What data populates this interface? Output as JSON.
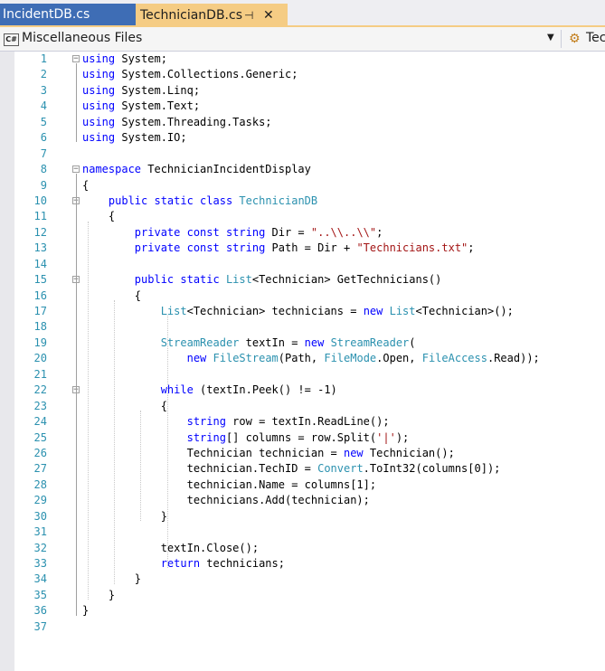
{
  "tabs": [
    {
      "label": "IncidentDB.cs",
      "active": false
    },
    {
      "label": "TechnicianDB.cs",
      "active": true,
      "pin_icon": "pin-icon",
      "close_icon": "close-icon"
    }
  ],
  "navbar": {
    "project_icon_text": "C#",
    "project_label": "Miscellaneous Files",
    "class_label": "Tec"
  },
  "code": [
    {
      "n": "1",
      "fold": "-",
      "parts": [
        [
          "kw",
          "using"
        ],
        [
          "",
          "System;"
        ]
      ]
    },
    {
      "n": "2",
      "parts": [
        [
          "kw",
          "using"
        ],
        [
          "",
          "System.Collections.Generic;"
        ]
      ]
    },
    {
      "n": "3",
      "parts": [
        [
          "kw",
          "using"
        ],
        [
          "",
          "System.Linq;"
        ]
      ]
    },
    {
      "n": "4",
      "parts": [
        [
          "kw",
          "using"
        ],
        [
          "",
          "System.Text;"
        ]
      ]
    },
    {
      "n": "5",
      "parts": [
        [
          "kw",
          "using"
        ],
        [
          "",
          "System.Threading.Tasks;"
        ]
      ]
    },
    {
      "n": "6",
      "parts": [
        [
          "kw",
          "using"
        ],
        [
          "",
          "System.IO;"
        ]
      ]
    },
    {
      "n": "7",
      "parts": []
    },
    {
      "n": "8",
      "fold": "-",
      "parts": [
        [
          "kw",
          "namespace"
        ],
        [
          "",
          " TechnicianIncidentDisplay"
        ]
      ]
    },
    {
      "n": "9",
      "parts": [
        [
          "",
          "{"
        ]
      ]
    },
    {
      "n": "10",
      "fold": "-",
      "parts": [
        [
          "",
          "    "
        ],
        [
          "kw",
          "public static class"
        ],
        [
          "",
          " "
        ],
        [
          "ty",
          "TechnicianDB"
        ]
      ]
    },
    {
      "n": "11",
      "parts": [
        [
          "",
          "    {"
        ]
      ]
    },
    {
      "n": "12",
      "parts": [
        [
          "",
          "        "
        ],
        [
          "kw",
          "private const string"
        ],
        [
          "",
          " Dir = "
        ],
        [
          "st",
          "\"..\\\\..\\\\\""
        ],
        [
          "",
          ";"
        ]
      ]
    },
    {
      "n": "13",
      "parts": [
        [
          "",
          "        "
        ],
        [
          "kw",
          "private const string"
        ],
        [
          "",
          " Path = Dir + "
        ],
        [
          "st",
          "\"Technicians.txt\""
        ],
        [
          "",
          ";"
        ]
      ]
    },
    {
      "n": "14",
      "parts": []
    },
    {
      "n": "15",
      "fold": "-",
      "parts": [
        [
          "",
          "        "
        ],
        [
          "kw",
          "public static"
        ],
        [
          "",
          " "
        ],
        [
          "ty",
          "List"
        ],
        [
          "",
          "<Technician> GetTechnicians()"
        ]
      ]
    },
    {
      "n": "16",
      "parts": [
        [
          "",
          "        {"
        ]
      ]
    },
    {
      "n": "17",
      "parts": [
        [
          "",
          "            "
        ],
        [
          "ty",
          "List"
        ],
        [
          "",
          "<Technician> technicians = "
        ],
        [
          "kw",
          "new"
        ],
        [
          "",
          " "
        ],
        [
          "ty",
          "List"
        ],
        [
          "",
          "<Technician>();"
        ]
      ]
    },
    {
      "n": "18",
      "parts": []
    },
    {
      "n": "19",
      "parts": [
        [
          "",
          "            "
        ],
        [
          "ty",
          "StreamReader"
        ],
        [
          "",
          " textIn = "
        ],
        [
          "kw",
          "new"
        ],
        [
          "",
          " "
        ],
        [
          "ty",
          "StreamReader"
        ],
        [
          "",
          "("
        ]
      ]
    },
    {
      "n": "20",
      "parts": [
        [
          "",
          "                "
        ],
        [
          "kw",
          "new"
        ],
        [
          "",
          " "
        ],
        [
          "ty",
          "FileStream"
        ],
        [
          "",
          "(Path, "
        ],
        [
          "ty",
          "FileMode"
        ],
        [
          "",
          ".Open, "
        ],
        [
          "ty",
          "FileAccess"
        ],
        [
          "",
          ".Read));"
        ]
      ]
    },
    {
      "n": "21",
      "parts": []
    },
    {
      "n": "22",
      "fold": "-",
      "parts": [
        [
          "",
          "            "
        ],
        [
          "kw",
          "while"
        ],
        [
          "",
          " (textIn.Peek() != -1)"
        ]
      ]
    },
    {
      "n": "23",
      "parts": [
        [
          "",
          "            {"
        ]
      ]
    },
    {
      "n": "24",
      "parts": [
        [
          "",
          "                "
        ],
        [
          "kw",
          "string"
        ],
        [
          "",
          " row = textIn.ReadLine();"
        ]
      ]
    },
    {
      "n": "25",
      "parts": [
        [
          "",
          "                "
        ],
        [
          "kw",
          "string"
        ],
        [
          "",
          "[] columns = row.Split("
        ],
        [
          "st",
          "'|'"
        ],
        [
          "",
          ");"
        ]
      ]
    },
    {
      "n": "26",
      "parts": [
        [
          "",
          "                Technician technician = "
        ],
        [
          "kw",
          "new"
        ],
        [
          "",
          " Technician();"
        ]
      ]
    },
    {
      "n": "27",
      "parts": [
        [
          "",
          "                technician.TechID = "
        ],
        [
          "ty",
          "Convert"
        ],
        [
          "",
          ".ToInt32(columns[0]);"
        ]
      ]
    },
    {
      "n": "28",
      "parts": [
        [
          "",
          "                technician.Name = columns[1];"
        ]
      ]
    },
    {
      "n": "29",
      "parts": [
        [
          "",
          "                technicians.Add(technician);"
        ]
      ]
    },
    {
      "n": "30",
      "parts": [
        [
          "",
          "            }"
        ]
      ]
    },
    {
      "n": "31",
      "parts": []
    },
    {
      "n": "32",
      "parts": [
        [
          "",
          "            textIn.Close();"
        ]
      ]
    },
    {
      "n": "33",
      "parts": [
        [
          "",
          "            "
        ],
        [
          "kw",
          "return"
        ],
        [
          "",
          " technicians;"
        ]
      ]
    },
    {
      "n": "34",
      "parts": [
        [
          "",
          "        }"
        ]
      ]
    },
    {
      "n": "35",
      "parts": [
        [
          "",
          "    }"
        ]
      ]
    },
    {
      "n": "36",
      "parts": [
        [
          "",
          "}"
        ]
      ]
    },
    {
      "n": "37",
      "parts": []
    }
  ],
  "colors": {
    "active_tab_bg": "#f5cc84",
    "inactive_tab_bg": "#3e6db5",
    "keyword": "#0000ff",
    "type": "#2b91af",
    "string": "#a31515",
    "line_number": "#2b91af"
  }
}
